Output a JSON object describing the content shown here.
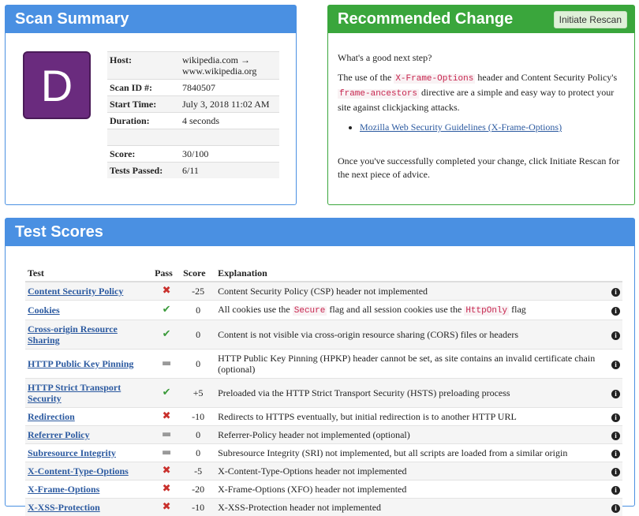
{
  "summary": {
    "title": "Scan Summary",
    "grade": "D",
    "rows": [
      {
        "key": "Host:",
        "value": "wikipedia.com → www.wikipedia.org"
      },
      {
        "key": "Scan ID #:",
        "value": "7840507"
      },
      {
        "key": "Start Time:",
        "value": "July 3, 2018 11:02 AM"
      },
      {
        "key": "Duration:",
        "value": "4 seconds"
      },
      {
        "key": "",
        "value": ""
      },
      {
        "key": "Score:",
        "value": "30/100"
      },
      {
        "key": "Tests Passed:",
        "value": "6/11"
      }
    ]
  },
  "recommend": {
    "title": "Recommended Change",
    "rescan_label": "Initiate Rescan",
    "question": "What's a good next step?",
    "p1_a": "The use of the ",
    "p1_code1": "X-Frame-Options",
    "p1_b": " header and Content Security Policy's ",
    "p1_code2": "frame-ancestors",
    "p1_c": " directive are a simple and easy way to protect your site against clickjacking attacks.",
    "link": "Mozilla Web Security Guidelines (X-Frame-Options)",
    "p2": "Once you've successfully completed your change, click Initiate Rescan for the next piece of advice."
  },
  "scores": {
    "title": "Test Scores",
    "headers": {
      "test": "Test",
      "pass": "Pass",
      "score": "Score",
      "explanation": "Explanation"
    },
    "rows": [
      {
        "test": "Content Security Policy",
        "pass": "fail",
        "score": "-25",
        "explanation": [
          "Content Security Policy (CSP) header not implemented"
        ]
      },
      {
        "test": "Cookies",
        "pass": "pass",
        "score": "0",
        "explanation": [
          "All cookies use the ",
          {
            "code": "Secure"
          },
          " flag and all session cookies use the ",
          {
            "code": "HttpOnly"
          },
          " flag"
        ]
      },
      {
        "test": "Cross-origin Resource Sharing",
        "pass": "pass",
        "score": "0",
        "explanation": [
          "Content is not visible via cross-origin resource sharing (CORS) files or headers"
        ]
      },
      {
        "test": "HTTP Public Key Pinning",
        "pass": "neutral",
        "score": "0",
        "explanation": [
          "HTTP Public Key Pinning (HPKP) header cannot be set, as site contains an invalid certificate chain (optional)"
        ]
      },
      {
        "test": "HTTP Strict Transport Security",
        "pass": "pass",
        "score": "+5",
        "explanation": [
          "Preloaded via the HTTP Strict Transport Security (HSTS) preloading process"
        ]
      },
      {
        "test": "Redirection",
        "pass": "fail",
        "score": "-10",
        "explanation": [
          "Redirects to HTTPS eventually, but initial redirection is to another HTTP URL"
        ]
      },
      {
        "test": "Referrer Policy",
        "pass": "neutral",
        "score": "0",
        "explanation": [
          "Referrer-Policy header not implemented (optional)"
        ]
      },
      {
        "test": "Subresource Integrity",
        "pass": "neutral",
        "score": "0",
        "explanation": [
          "Subresource Integrity (SRI) not implemented, but all scripts are loaded from a similar origin"
        ]
      },
      {
        "test": "X-Content-Type-Options",
        "pass": "fail",
        "score": "-5",
        "explanation": [
          "X-Content-Type-Options header not implemented"
        ]
      },
      {
        "test": "X-Frame-Options",
        "pass": "fail",
        "score": "-20",
        "explanation": [
          "X-Frame-Options (XFO) header not implemented"
        ]
      },
      {
        "test": "X-XSS-Protection",
        "pass": "fail",
        "score": "-10",
        "explanation": [
          "X-XSS-Protection header not implemented"
        ]
      }
    ]
  },
  "icons": {
    "fail": "✖",
    "pass": "✔",
    "neutral": "▬",
    "info": "i"
  },
  "colors": {
    "summary_blue": "#4a90e2",
    "recommend_green": "#3aa63c",
    "grade_purple": "#6a2b7e"
  }
}
